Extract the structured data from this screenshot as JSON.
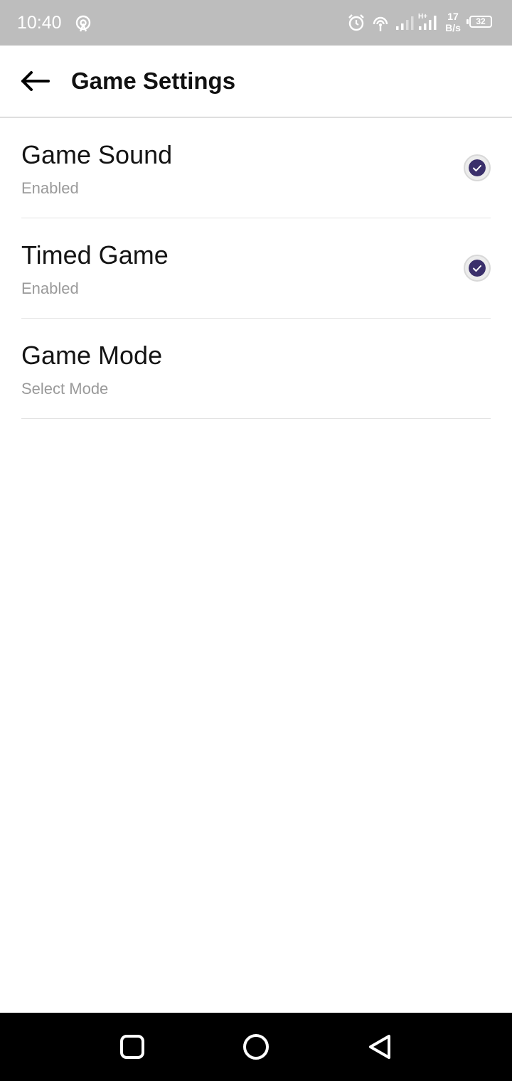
{
  "status_bar": {
    "time": "10:40",
    "net_speed_value": "17",
    "net_speed_unit": "B/s",
    "battery_level": "32",
    "network_type": "H+"
  },
  "app_bar": {
    "title": "Game Settings"
  },
  "settings": [
    {
      "title": "Game Sound",
      "summary": "Enabled",
      "checked": true
    },
    {
      "title": "Timed Game",
      "summary": "Enabled",
      "checked": true
    },
    {
      "title": "Game Mode",
      "summary": "Select Mode"
    }
  ],
  "colors": {
    "accent": "#3a2f6b",
    "status_bar_bg": "#bdbdbd",
    "summary_text": "#9a9a9a"
  },
  "icons": {
    "back": "arrow-left-icon",
    "nav_recents": "square-icon",
    "nav_home": "circle-icon",
    "nav_back": "triangle-back-icon"
  }
}
